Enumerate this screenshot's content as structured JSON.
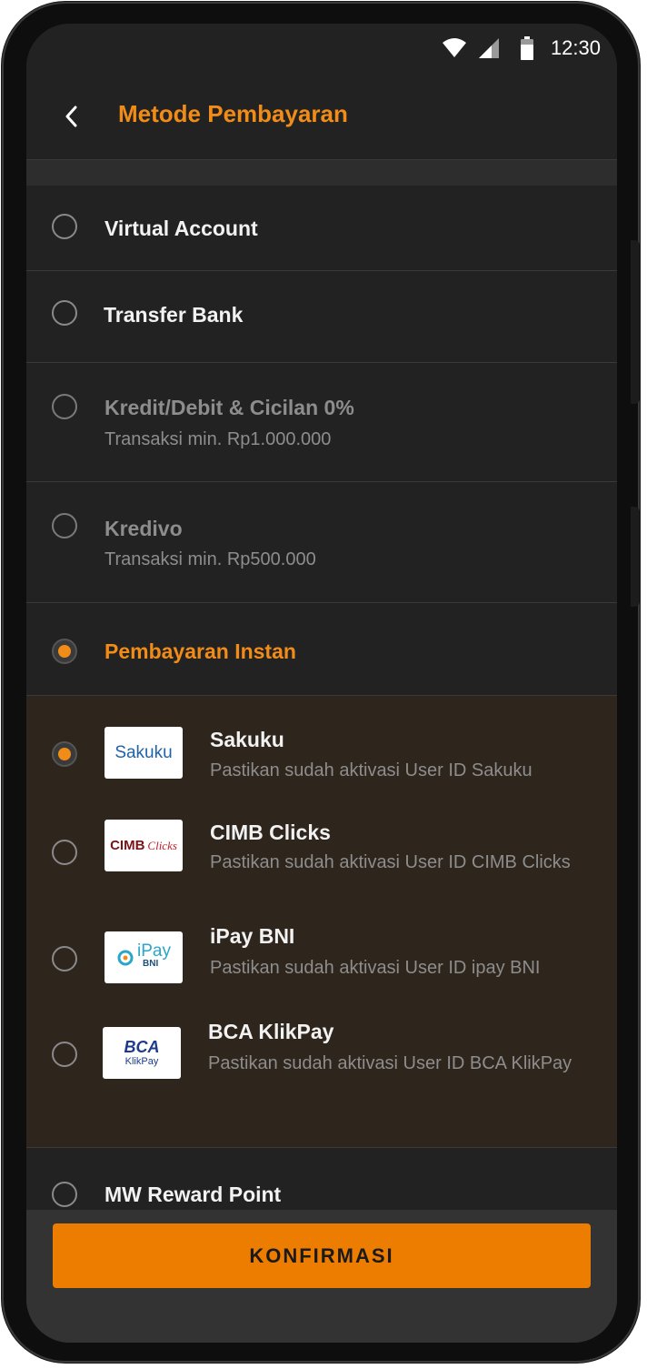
{
  "status_bar": {
    "time": "12:30"
  },
  "header": {
    "title": "Metode Pembayaran"
  },
  "methods": [
    {
      "title": "Virtual Account"
    },
    {
      "title": "Transfer Bank"
    },
    {
      "title": "Kredit/Debit & Cicilan 0%",
      "subtitle": "Transaksi min. Rp1.000.000"
    },
    {
      "title": "Kredivo",
      "subtitle": "Transaksi min. Rp500.000"
    },
    {
      "title": "Pembayaran Instan"
    }
  ],
  "instant_options": [
    {
      "title": "Sakuku",
      "subtitle": "Pastikan sudah aktivasi User ID Sakuku",
      "logo_text": "Sakuku"
    },
    {
      "title": "CIMB Clicks",
      "subtitle": "Pastikan sudah aktivasi User ID CIMB Clicks",
      "logo_text": "CIMB",
      "logo_text2": "Clicks"
    },
    {
      "title": "iPay BNI",
      "subtitle": "Pastikan sudah aktivasi User ID ipay BNI",
      "logo_text": "iPay",
      "logo_text2": "BNI"
    },
    {
      "title": "BCA KlikPay",
      "subtitle": "Pastikan sudah aktivasi User ID BCA KlikPay",
      "logo_text": "BCA",
      "logo_text2": "KlikPay"
    }
  ],
  "reward": {
    "title": "MW Reward Point"
  },
  "confirm_label": "KONFIRMASI",
  "colors": {
    "accent": "#f28c18",
    "button": "#ed7d00",
    "background": "#222222",
    "instant_bg": "#2e251d"
  }
}
